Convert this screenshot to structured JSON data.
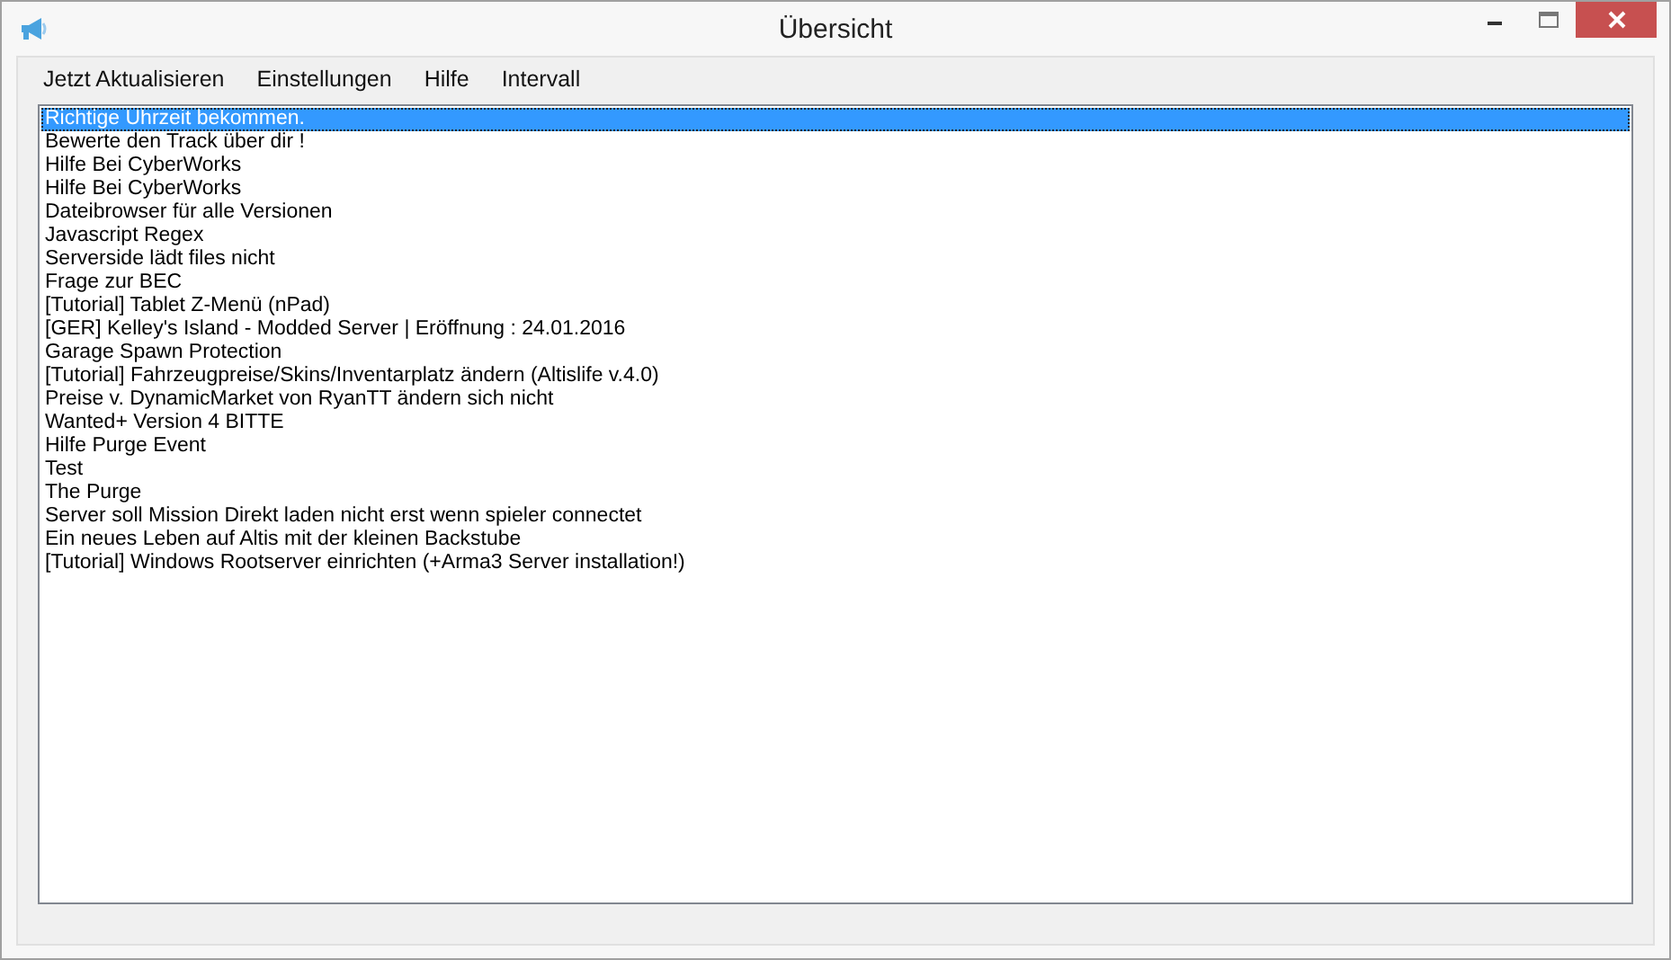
{
  "window": {
    "title": "Übersicht"
  },
  "menu": [
    {
      "label": "Jetzt Aktualisieren"
    },
    {
      "label": "Einstellungen"
    },
    {
      "label": "Hilfe"
    },
    {
      "label": "Intervall"
    }
  ],
  "list": [
    {
      "text": "Richtige Uhrzeit bekommen.",
      "selected": true
    },
    {
      "text": "Bewerte den Track über dir !",
      "selected": false
    },
    {
      "text": "Hilfe Bei CyberWorks",
      "selected": false
    },
    {
      "text": "Hilfe Bei CyberWorks",
      "selected": false
    },
    {
      "text": "Dateibrowser für alle Versionen",
      "selected": false
    },
    {
      "text": "Javascript Regex",
      "selected": false
    },
    {
      "text": "Serverside lädt files nicht",
      "selected": false
    },
    {
      "text": "Frage zur BEC",
      "selected": false
    },
    {
      "text": "[Tutorial] Tablet Z-Menü (nPad)",
      "selected": false
    },
    {
      "text": "[GER] Kelley's Island - Modded Server | Eröffnung : 24.01.2016",
      "selected": false
    },
    {
      "text": "Garage Spawn Protection",
      "selected": false
    },
    {
      "text": "[Tutorial] Fahrzeugpreise/Skins/Inventarplatz ändern (Altislife v.4.0)",
      "selected": false
    },
    {
      "text": "Preise v. DynamicMarket von RyanTT ändern sich nicht",
      "selected": false
    },
    {
      "text": "Wanted+ Version 4 BITTE",
      "selected": false
    },
    {
      "text": "Hilfe Purge Event",
      "selected": false
    },
    {
      "text": "Test",
      "selected": false
    },
    {
      "text": "The Purge",
      "selected": false
    },
    {
      "text": "Server soll Mission Direkt laden nicht erst wenn spieler connectet",
      "selected": false
    },
    {
      "text": "Ein neues Leben auf Altis mit der kleinen Backstube",
      "selected": false
    },
    {
      "text": "[Tutorial] Windows Rootserver einrichten (+Arma3 Server installation!)",
      "selected": false
    }
  ]
}
